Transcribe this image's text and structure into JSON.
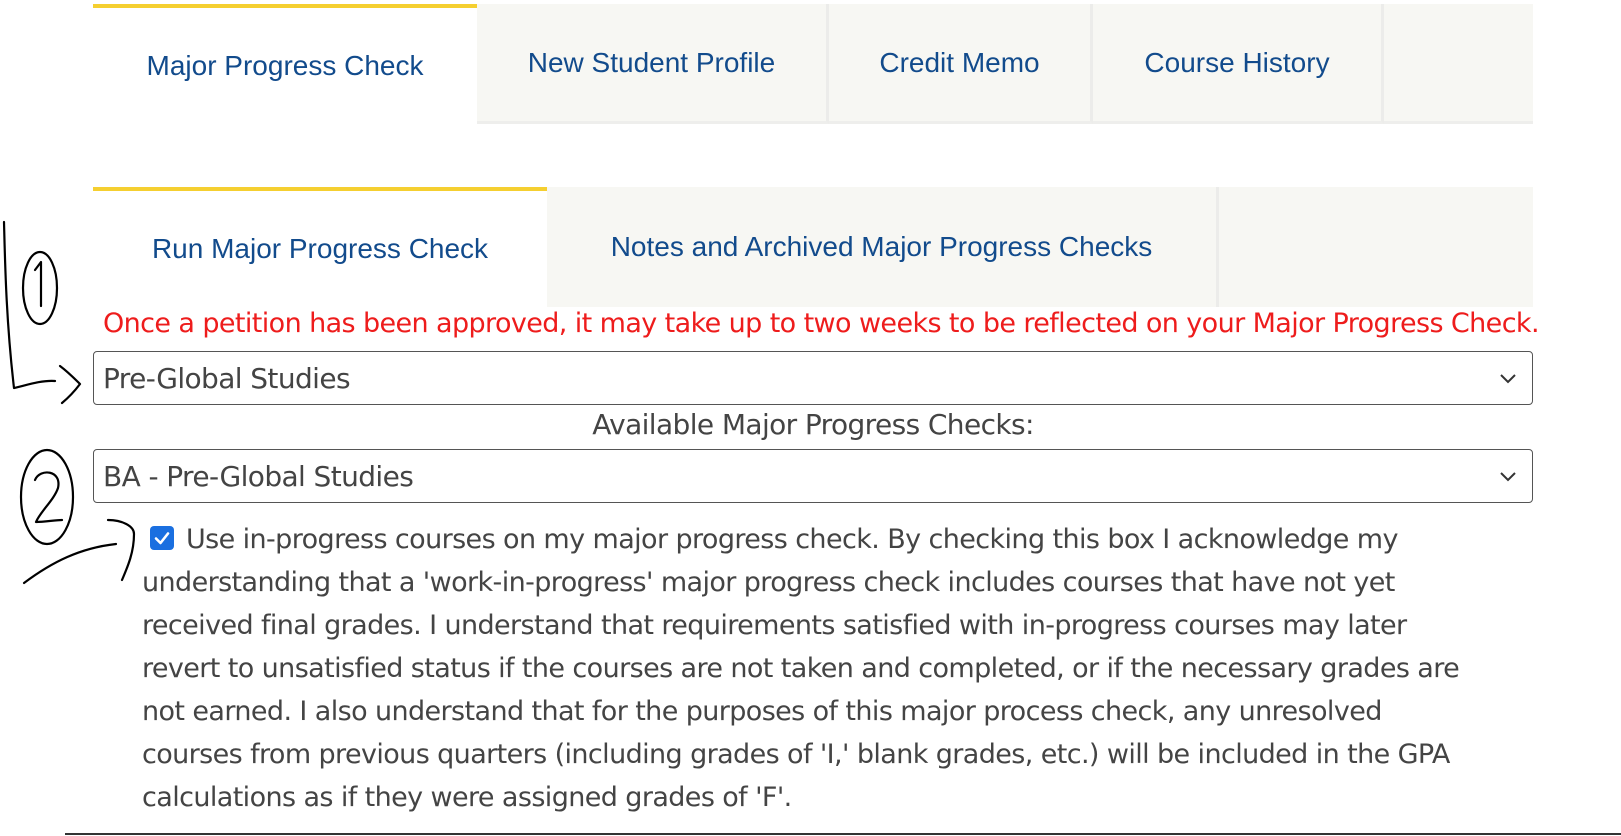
{
  "top_tabs": [
    {
      "label": "Major Progress Check",
      "active": true
    },
    {
      "label": "New Student Profile",
      "active": false
    },
    {
      "label": "Credit Memo",
      "active": false
    },
    {
      "label": "Course History",
      "active": false
    }
  ],
  "sub_tabs": [
    {
      "label": "Run Major Progress Check",
      "active": true
    },
    {
      "label": "Notes and Archived Major Progress Checks",
      "active": false
    }
  ],
  "notice": "Once a petition has been approved, it may take up to two weeks to be reflected on your Major Progress Check.",
  "major_select": {
    "value": "Pre-Global Studies"
  },
  "available_label": "Available Major Progress Checks:",
  "check_select": {
    "value": "BA - Pre-Global Studies"
  },
  "in_progress_checkbox": {
    "checked": true,
    "text": "Use in-progress courses on my major progress check. By checking this box I acknowledge my understanding that a 'work-in-progress' major progress check includes courses that have not yet received final grades. I understand that requirements satisfied with in-progress courses may later revert to unsatisfied status if the courses are not taken and completed, or if the necessary grades are not earned. I also understand that for the purposes of this major process check, any unresolved courses from previous quarters (including grades of 'I,' blank grades, etc.) will be included in the GPA calculations as if they were assigned grades of 'F'."
  },
  "colors": {
    "tab_text": "#124b8c",
    "active_accent": "#f5cf30",
    "notice": "#ee1c1c",
    "checkbox": "#1a6fe0"
  },
  "annotations": [
    {
      "icon": "handwritten-number-1-arrow-icon"
    },
    {
      "icon": "handwritten-number-2-arrow-icon"
    }
  ]
}
